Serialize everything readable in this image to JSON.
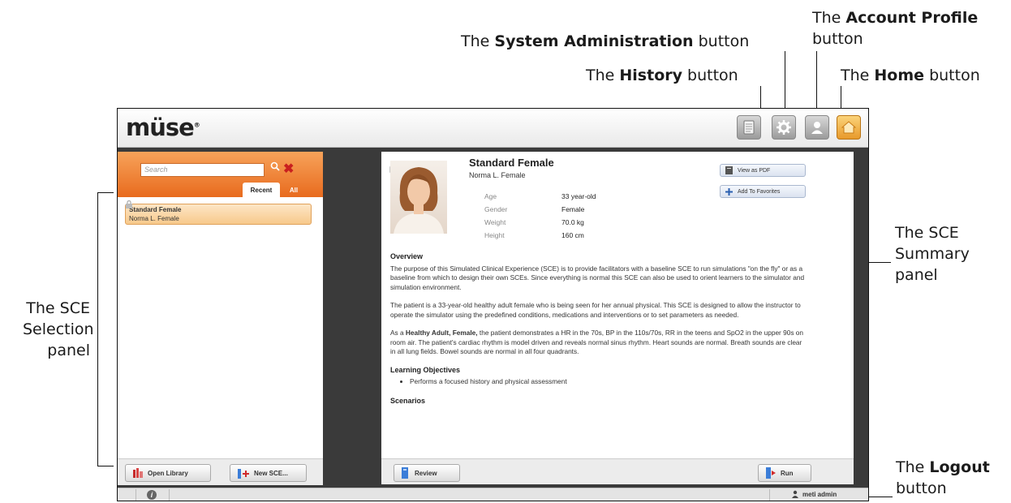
{
  "callouts": {
    "sysadmin": {
      "prefix": "The ",
      "bold": "System Administration",
      "suffix": " button"
    },
    "account": {
      "prefix": "The ",
      "bold": "Account Profile",
      "line2": "button"
    },
    "history": {
      "prefix": "The ",
      "bold": "History",
      "suffix": " button"
    },
    "home": {
      "prefix": "The ",
      "bold": "Home",
      "suffix": " button"
    },
    "sce_summary": [
      "The SCE",
      "Summary",
      "panel"
    ],
    "sce_selection": [
      "The SCE",
      "Selection",
      "panel"
    ],
    "logout": {
      "prefix": "The ",
      "bold": "Logout",
      "line2": "button"
    }
  },
  "app": {
    "logo": "müse",
    "logo_mark": "®",
    "toolbar": {
      "history_icon": "document-icon",
      "sysadmin_icon": "gear-icon",
      "account_icon": "user-icon",
      "home_icon": "house-icon"
    },
    "selection": {
      "search_placeholder": "Search",
      "tabs": {
        "recent": "Recent",
        "all": "All"
      },
      "items": [
        {
          "title": "Standard Female",
          "subtitle": "Norma L. Female"
        }
      ],
      "open_library": "Open Library",
      "new_sce": "New SCE..."
    },
    "summary": {
      "name": "Standard Female",
      "subtitle": "Norma L. Female",
      "fields": [
        {
          "label": "Age",
          "value": "33 year-old"
        },
        {
          "label": "Gender",
          "value": "Female"
        },
        {
          "label": "Weight",
          "value": "70.0 kg"
        },
        {
          "label": "Height",
          "value": "160 cm"
        }
      ],
      "view_pdf": "View as PDF",
      "add_favorites": "Add To Favorites",
      "overview_heading": "Overview",
      "overview_p1": "The purpose of this Simulated Clinical Experience (SCE) is to provide facilitators with a baseline SCE to run simulations \"on the fly\" or as a baseline from which to design their own SCEs. Since everything is normal this SCE can also be used to orient learners to the simulator and simulation environment.",
      "overview_p2": "The patient is a 33-year-old healthy adult female who is being seen for her annual physical. This SCE is designed to allow the instructor to operate the simulator using the predefined conditions, medications and interventions or to set parameters as needed.",
      "overview_p3_prefix": "As a ",
      "overview_p3_bold": "Healthy Adult, Female,",
      "overview_p3_rest": " the patient demonstrates a HR in the 70s, BP in the 110s/70s, RR in the teens and SpO2 in the upper 90s on room air. The patient's cardiac rhythm is model driven and reveals normal sinus rhythm. Heart sounds are normal. Breath sounds are clear in all lung fields. Bowel sounds are normal in all four quadrants.",
      "objectives_heading": "Learning Objectives",
      "objectives": [
        "Performs a focused history and physical assessment"
      ],
      "scenarios_heading": "Scenarios",
      "review": "Review",
      "run": "Run"
    },
    "status": {
      "user": "meti admin"
    }
  }
}
